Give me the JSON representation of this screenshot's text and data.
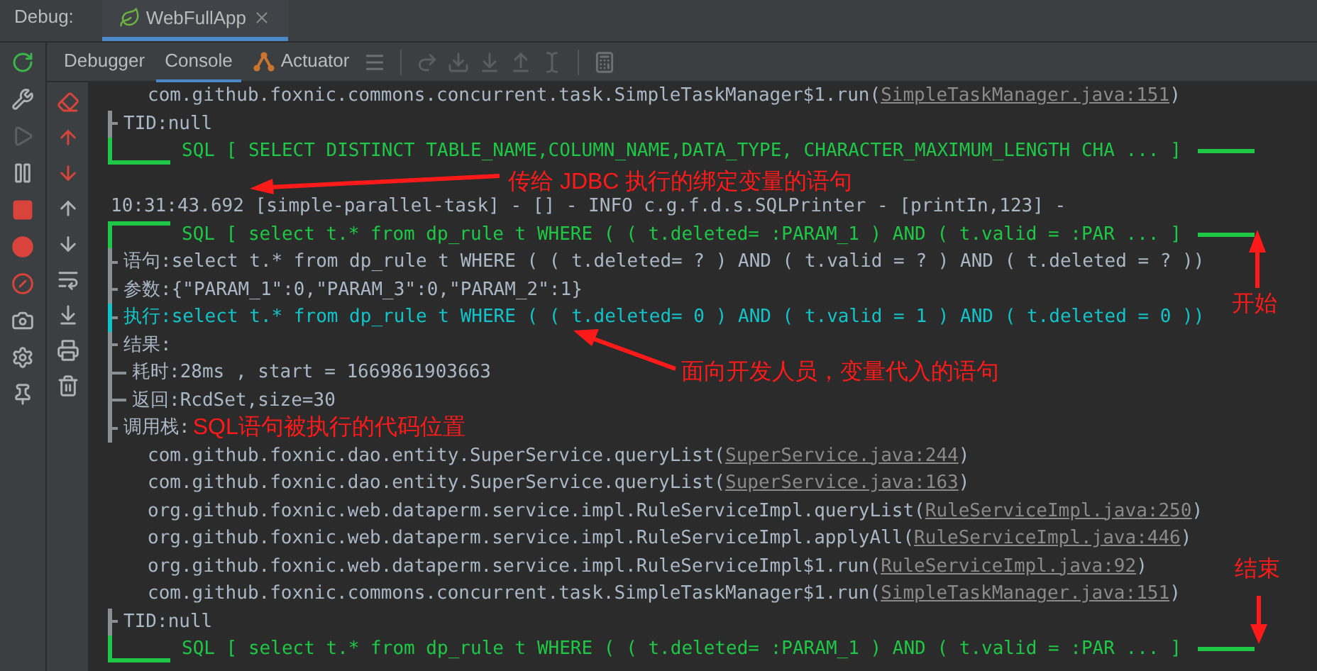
{
  "header": {
    "label": "Debug:",
    "tabs": [
      {
        "label": "WebFullApp",
        "selected": true
      }
    ]
  },
  "toolbar": {
    "tabs": [
      {
        "label": "Debugger",
        "selected": false,
        "kind": "text"
      },
      {
        "label": "Console",
        "selected": true,
        "kind": "text"
      },
      {
        "label": "Actuator",
        "selected": false,
        "kind": "plugin"
      }
    ]
  },
  "console": {
    "lines": [
      {
        "kind": "stack",
        "text": "com.github.foxnic.commons.concurrent.task.SimpleTaskManager$1.run(",
        "link": "SimpleTaskManager.java:151",
        "suffix": ")"
      },
      {
        "kind": "node",
        "label": "TID:",
        "value": "null"
      },
      {
        "kind": "sql_end",
        "text": "SQL [ SELECT DISTINCT TABLE_NAME,COLUMN_NAME,DATA_TYPE, CHARACTER_MAXIMUM_LENGTH CHA ...  ]"
      },
      {
        "kind": "blank"
      },
      {
        "kind": "log",
        "text": "10:31:43.692 [simple-parallel-task] - [] - INFO  c.g.f.d.s.SQLPrinter - [printIn,123] -"
      },
      {
        "kind": "sql_start",
        "text": "SQL [ select t.* from dp_rule t WHERE ( ( t.deleted= :PARAM_1 ) AND ( t.valid = :PAR ...  ]"
      },
      {
        "kind": "node",
        "label": "语句:",
        "value": "select t.* from dp_rule t WHERE ( ( t.deleted= ? ) AND ( t.valid = ? ) AND ( t.deleted = ? ))"
      },
      {
        "kind": "node",
        "label": "参数:",
        "value": "{\"PARAM_1\":0,\"PARAM_3\":0,\"PARAM_2\":1}"
      },
      {
        "kind": "exec",
        "label": "执行:",
        "value": "select t.* from dp_rule t WHERE ( ( t.deleted= 0 ) AND ( t.valid = 1 ) AND ( t.deleted = 0 ))"
      },
      {
        "kind": "node",
        "label": "结果:"
      },
      {
        "kind": "subnode",
        "label": "耗时:",
        "value": "28ms , start = 1669861903663"
      },
      {
        "kind": "subnode",
        "label": "返回:",
        "value": "RcdSet,size=30"
      },
      {
        "kind": "node",
        "label": "调用栈:",
        "note": "SQL语句被执行的代码位置"
      },
      {
        "kind": "stack",
        "text": "com.github.foxnic.dao.entity.SuperService.queryList(",
        "link": "SuperService.java:244",
        "suffix": ")"
      },
      {
        "kind": "stack",
        "text": "com.github.foxnic.dao.entity.SuperService.queryList(",
        "link": "SuperService.java:163",
        "suffix": ")"
      },
      {
        "kind": "stack",
        "text": "org.github.foxnic.web.dataperm.service.impl.RuleServiceImpl.queryList(",
        "link": "RuleServiceImpl.java:250",
        "suffix": ")"
      },
      {
        "kind": "stack",
        "text": "org.github.foxnic.web.dataperm.service.impl.RuleServiceImpl.applyAll(",
        "link": "RuleServiceImpl.java:446",
        "suffix": ")"
      },
      {
        "kind": "stack",
        "text": "org.github.foxnic.web.dataperm.service.impl.RuleServiceImpl$1.run(",
        "link": "RuleServiceImpl.java:92",
        "suffix": ")"
      },
      {
        "kind": "stack",
        "text": "com.github.foxnic.commons.concurrent.task.SimpleTaskManager$1.run(",
        "link": "SimpleTaskManager.java:151",
        "suffix": ")"
      },
      {
        "kind": "node",
        "label": "TID:",
        "value": "null"
      },
      {
        "kind": "sql_end",
        "text": "SQL [ select t.* from dp_rule t WHERE ( ( t.deleted= :PARAM_1 ) AND ( t.valid = :PAR ...  ]"
      }
    ]
  },
  "annotations": [
    {
      "text": "传给 JDBC 执行的绑定变量的语句"
    },
    {
      "text": "面向开发人员，变量代入的语句"
    },
    {
      "text": "开始"
    },
    {
      "text": "结束"
    }
  ]
}
